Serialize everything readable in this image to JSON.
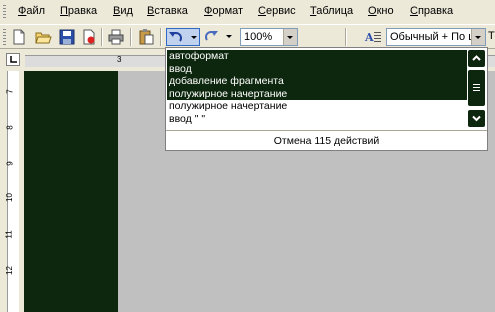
{
  "menubar": {
    "items": [
      {
        "label": "Файл",
        "key": "Ф",
        "rest": "айл"
      },
      {
        "label": "Правка",
        "key": "П",
        "rest": "равка"
      },
      {
        "label": "Вид",
        "key": "В",
        "rest": "ид"
      },
      {
        "label": "Вставка",
        "key": "В",
        "rest": "ставка"
      },
      {
        "label": "Формат",
        "key": "Ф",
        "rest": "ормат"
      },
      {
        "label": "Сервис",
        "key": "С",
        "rest": "ервис"
      },
      {
        "label": "Таблица",
        "key": "Т",
        "rest": "аблица"
      },
      {
        "label": "Окно",
        "key": "О",
        "rest": "кно"
      },
      {
        "label": "Справка",
        "key": "С",
        "rest": "правка"
      }
    ]
  },
  "toolbar": {
    "zoom_value": "100%",
    "style_value": "Обычный + По ц",
    "font_prefix": "T"
  },
  "undo_dropdown": {
    "items": [
      {
        "label": "автоформат",
        "selected": true
      },
      {
        "label": "ввод",
        "selected": true
      },
      {
        "label": "добавление фрагмента",
        "selected": true
      },
      {
        "label": "полужирное начертание",
        "selected": true
      },
      {
        "label": "полужирное начертание",
        "selected": false
      },
      {
        "label": "ввод \" \"",
        "selected": false
      }
    ],
    "footer": "Отмена 115 действий"
  },
  "ruler": {
    "vertical_numbers": [
      "7",
      "8",
      "9",
      "10",
      "11",
      "12"
    ],
    "horizontal_first": "3"
  },
  "colors": {
    "selection": "#0d260e",
    "chrome": "#ece9d8",
    "workspace": "#c0c0c0"
  }
}
